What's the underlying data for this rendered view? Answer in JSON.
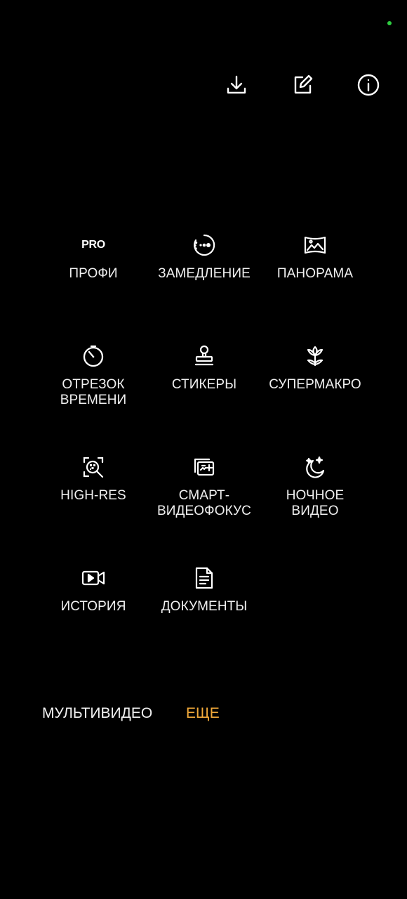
{
  "toolbar": {
    "download_icon": "download-icon",
    "edit_icon": "edit-icon",
    "info_icon": "info-icon"
  },
  "modes": [
    {
      "id": "pro",
      "label": "ПРОФИ",
      "icon": "pro-icon",
      "icon_text": "PRO"
    },
    {
      "id": "slowmo",
      "label": "ЗАМЕДЛЕНИЕ",
      "icon": "slowmo-icon"
    },
    {
      "id": "panorama",
      "label": "ПАНОРАМА",
      "icon": "panorama-icon"
    },
    {
      "id": "timelapse",
      "label": "ОТРЕЗОК\nВРЕМЕНИ",
      "icon": "timer-icon"
    },
    {
      "id": "stickers",
      "label": "СТИКЕРЫ",
      "icon": "stamp-icon"
    },
    {
      "id": "supermacro",
      "label": "СУПЕРМАКРО",
      "icon": "flower-icon"
    },
    {
      "id": "highres",
      "label": "HIGH-RES",
      "icon": "high-res-icon"
    },
    {
      "id": "smartfocus",
      "label": "СМАРТ-\nВИДЕОФОКУС",
      "icon": "smart-focus-icon"
    },
    {
      "id": "nightvideo",
      "label": "НОЧНОЕ\nВИДЕО",
      "icon": "moon-icon"
    },
    {
      "id": "story",
      "label": "ИСТОРИЯ",
      "icon": "video-camera-icon"
    },
    {
      "id": "documents",
      "label": "ДОКУМЕНТЫ",
      "icon": "document-icon"
    }
  ],
  "bottom_tabs": {
    "multivideo": "МУЛЬТИВИДЕО",
    "more": "ЕЩЕ"
  },
  "colors": {
    "background": "#000000",
    "text": "#f2f2f2",
    "accent": "#f1a93a",
    "status_dot": "#2ecc40"
  }
}
